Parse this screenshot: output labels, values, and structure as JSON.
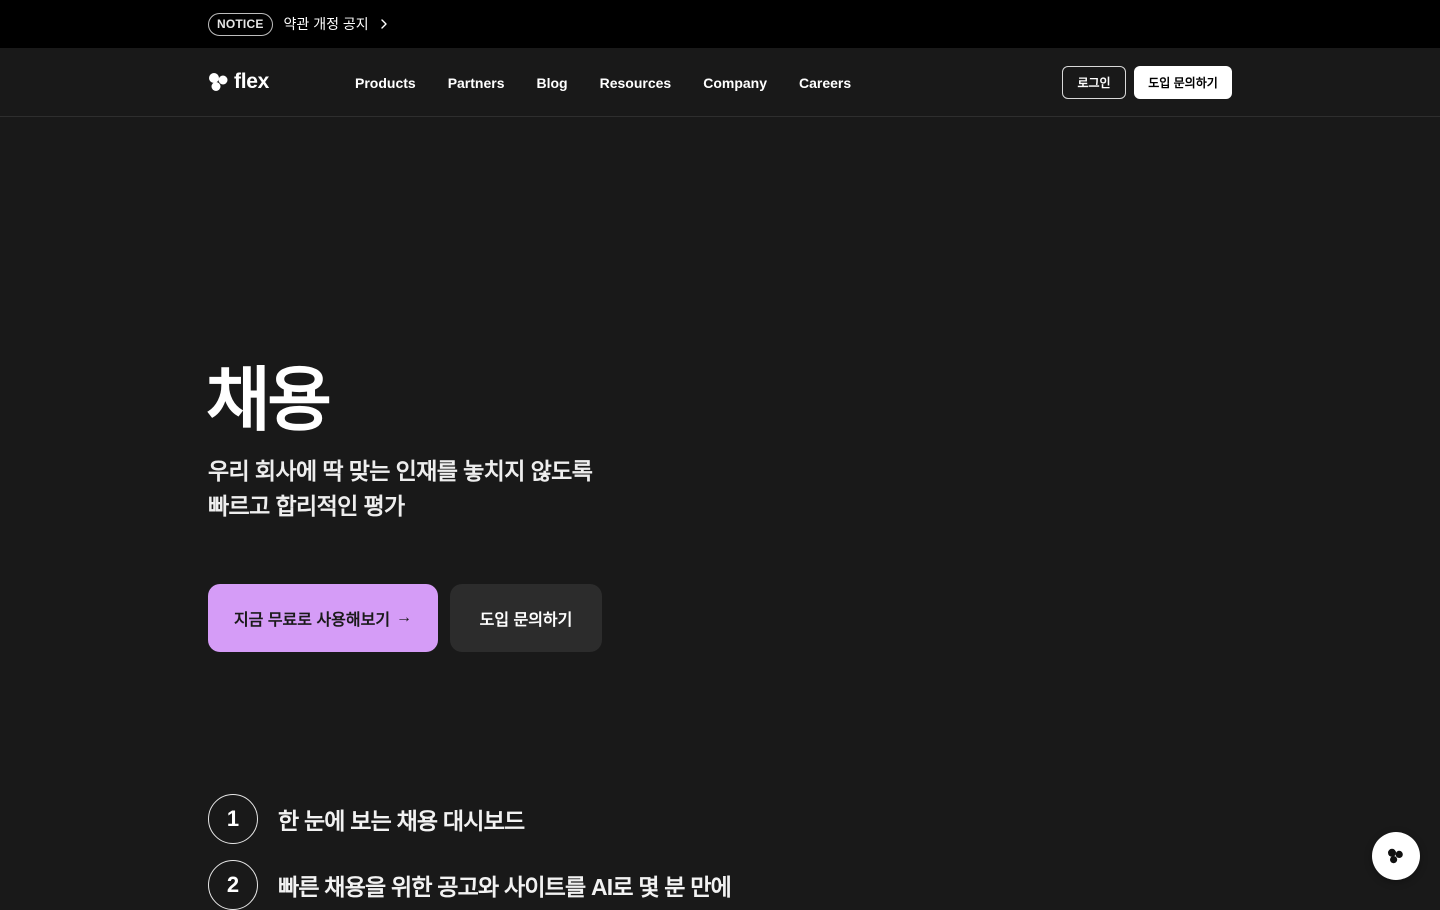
{
  "notice": {
    "badge": "NOTICE",
    "text": "약관 개정 공지"
  },
  "header": {
    "logo_text": "flex",
    "nav": [
      "Products",
      "Partners",
      "Blog",
      "Resources",
      "Company",
      "Careers"
    ],
    "login_label": "로그인",
    "inquiry_label": "도입 문의하기"
  },
  "hero": {
    "title": "채용",
    "subtitle_line1": "우리 회사에 딱 맞는 인재를 놓치지 않도록",
    "subtitle_line2": "빠르고 합리적인 평가",
    "cta_primary": "지금 무료로 사용해보기",
    "cta_primary_arrow": "→",
    "cta_secondary": "도입 문의하기"
  },
  "features": [
    {
      "number": "1",
      "label": "한 눈에 보는 채용 대시보드"
    },
    {
      "number": "2",
      "label": "빠른 채용을 위한 공고와 사이트를 AI로 몇 분 만에"
    }
  ],
  "colors": {
    "background": "#191919",
    "notice_bar": "#000000",
    "accent": "#d59cf7",
    "secondary_button": "#2c2c2c"
  },
  "icons": {
    "notice_chevron": "chevron-right-icon",
    "logo": "flex-logo-icon",
    "floating": "flex-logo-icon"
  }
}
